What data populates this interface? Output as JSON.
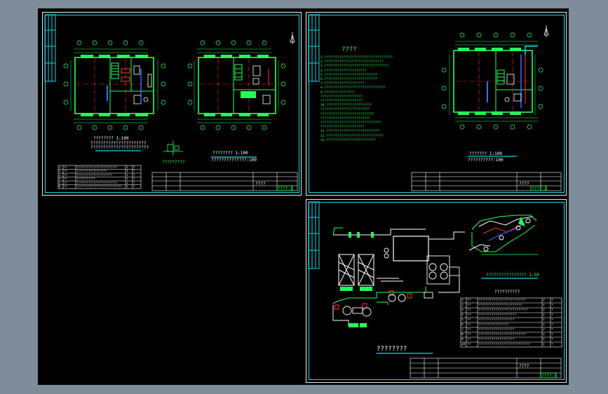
{
  "sheets": {
    "sheet1": {
      "plan_title_left": "????????  1:100",
      "plan_note_left_1": "??????????????????????",
      "plan_note_left_2": "???????????????????????",
      "plan_title_right": "????????  1:100",
      "plan_note_right": "??????????????:100",
      "legend_caption": "?????????",
      "material_table": {
        "rows": [
          [
            "1",
            "??",
            "????????????????????????",
            "1",
            "?"
          ],
          [
            "2",
            "??",
            "??????????????????",
            "1",
            "?"
          ],
          [
            "3",
            "??",
            "?????????????????????",
            "1",
            "?"
          ],
          [
            "4",
            "??",
            "???????????",
            "1",
            "?"
          ],
          [
            "5",
            "??",
            "????????????????????????",
            "1",
            "?"
          ],
          [
            "6",
            "??",
            "???????????????????????????",
            "1",
            "?"
          ]
        ]
      },
      "title_block": {
        "dwg_name": "????",
        "dwg_no": "????-1"
      }
    },
    "sheet2": {
      "notes_heading": "????",
      "notes_lines": [
        "1.????????????????????????????????????",
        "2.???????????????????????????????",
        "3.??????????????????????????????????",
        "4.??????????????????????",
        "5.????????????????????????????",
        "6.????????????????????????????",
        "7.?????????????????????",
        "8.????????????????????????????????",
        "9.????????????????",
        "  ??????????????????????",
        "  ??????????????????????",
        "10.????????????????????????",
        "   ??????????????????????????",
        "   ????????????????????????????",
        "   ??????????????????????????",
        "   ????????????????????????????????",
        "   ???????????????????????",
        "11.????????????????????????????",
        "12.??????????????????????????????",
        "13.??????????????????????????"
      ],
      "plan_title": "???????  1:100",
      "plan_note": "??????????:100",
      "title_block": {
        "dwg_name": "????",
        "dwg_no": "????-2"
      }
    },
    "sheet3": {
      "system_diagram_title": "????????",
      "iso_title": "????????????????  1:50",
      "table_caption": "??????????",
      "equipment_table": {
        "rows": [
          [
            "1",
            "??",
            "?????????????????????????",
            "2",
            "?"
          ],
          [
            "2",
            "??",
            "???????????????????????",
            "1",
            "?"
          ],
          [
            "3",
            "??",
            "??????????????????????????",
            "2",
            "?"
          ],
          [
            "4",
            "??",
            "????????????????????",
            "2",
            "?"
          ],
          [
            "5",
            "??",
            "???????????????????",
            "1",
            "?"
          ],
          [
            "6",
            "??",
            "????????????????",
            "1",
            "?"
          ],
          [
            "7",
            "??",
            "???????????????????",
            "2",
            "?"
          ],
          [
            "8",
            "??",
            "?????????????????????????",
            "1",
            "?"
          ],
          [
            "9",
            "??",
            "???????????????????",
            "1",
            "?"
          ],
          [
            "10",
            "??",
            "???????????????????????????",
            "1",
            "?"
          ]
        ]
      },
      "title_block": {
        "dwg_name": "????",
        "dwg_no": "????-3"
      }
    }
  },
  "colors": {
    "background": "#000000",
    "outer": "#7f8c99",
    "frame": "#17d7e8",
    "walls": "#22ff55",
    "axis": "#ff3333",
    "pipe_blue": "#3a6bff",
    "pipe_red": "#ff2a2a",
    "text": "#ffffff"
  }
}
